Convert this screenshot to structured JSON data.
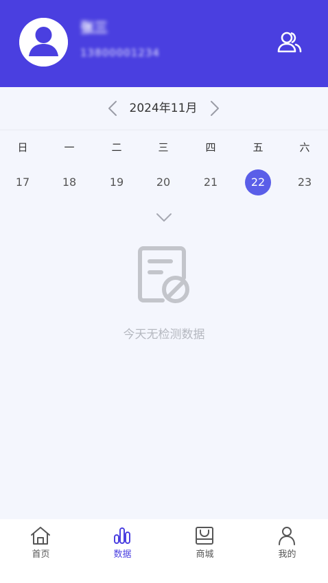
{
  "header": {
    "user_name": "张三",
    "user_phone": "13800001234",
    "avatar_icon": "user-avatar-icon",
    "family_icon": "users-icon",
    "bg_color": "#4a3fe0"
  },
  "calendar": {
    "month_label": "2024年11月",
    "prev_icon": "chevron-left-icon",
    "next_icon": "chevron-right-icon",
    "weekdays": [
      "日",
      "一",
      "二",
      "三",
      "四",
      "五",
      "六"
    ],
    "days": [
      "17",
      "18",
      "19",
      "20",
      "21",
      "22",
      "23"
    ],
    "selected_day": "22",
    "selected_color": "#5a5ee8",
    "expand_icon": "chevron-down-icon"
  },
  "empty_state": {
    "icon": "no-data-document-icon",
    "message": "今天无检测数据"
  },
  "tabbar": {
    "active_color": "#4a3fe0",
    "items": [
      {
        "label": "首页",
        "icon": "home-icon",
        "active": false
      },
      {
        "label": "数据",
        "icon": "bar-chart-icon",
        "active": true
      },
      {
        "label": "商城",
        "icon": "shop-bag-icon",
        "active": false
      },
      {
        "label": "我的",
        "icon": "person-icon",
        "active": false
      }
    ]
  }
}
